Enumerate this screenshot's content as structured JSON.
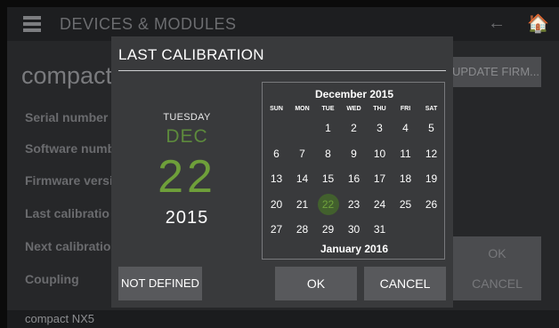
{
  "header": {
    "title": "DEVICES & MODULES",
    "menu_icon": "menu-icon",
    "back_icon": "arrow-left-icon",
    "home_icon": "home-icon",
    "back_glyph": "←",
    "home_glyph": "🏠"
  },
  "device": {
    "name": "compact",
    "update_button": "UPDATE FIRM...",
    "fields": [
      "Serial number",
      "Software numb",
      "Firmware versi",
      "Last calibratio",
      "Next calibratio",
      "Coupling"
    ],
    "ok_label": "OK",
    "cancel_label": "CANCEL"
  },
  "status_bar": {
    "text": "compact NX5"
  },
  "dialog": {
    "title": "LAST CALIBRATION",
    "selected_date": {
      "weekday": "TUESDAY",
      "month": "DEC",
      "day": "22",
      "year": "2015"
    },
    "calendar": {
      "month_label": "December 2015",
      "next_month_label": "January 2016",
      "weekdays": [
        "SUN",
        "MON",
        "TUE",
        "WED",
        "THU",
        "FRI",
        "SAT"
      ],
      "first_weekday_index": 2,
      "days_in_month": 31,
      "selected_day": 22
    },
    "buttons": {
      "not_defined": "NOT DEFINED",
      "ok": "OK",
      "cancel": "CANCEL"
    }
  },
  "colors": {
    "accent_green": "#6e9f3a",
    "selected_circle": "#42602d",
    "dialog_bg": "#393a3c",
    "button_bg": "#58595c"
  }
}
